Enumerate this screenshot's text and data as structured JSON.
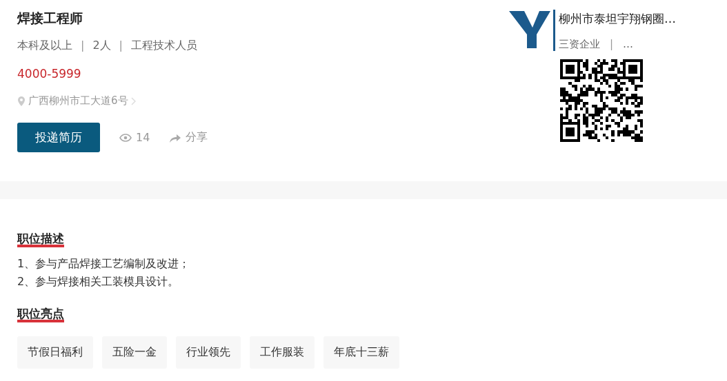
{
  "job": {
    "title": "焊接工程师",
    "meta": [
      "本科及以上",
      "2人",
      "工程技术人员"
    ],
    "meta_separator": "|",
    "salary": "4000-5999",
    "address": "广西柳州市工大道6号",
    "apply_button": "投递简历",
    "views": "14",
    "share": "分享"
  },
  "company": {
    "name": "柳州市泰坦宇翔钢圈…",
    "tags": [
      "三资企业",
      "…"
    ],
    "tag_separator": "|"
  },
  "description": {
    "title": "职位描述",
    "lines": [
      "1、参与产品焊接工艺编制及改进；",
      "2、参与焊接相关工装模具设计。"
    ]
  },
  "highlights": {
    "title": "职位亮点",
    "tags": [
      "节假日福利",
      "五险一金",
      "行业领先",
      "工作服装",
      "年底十三薪"
    ]
  }
}
